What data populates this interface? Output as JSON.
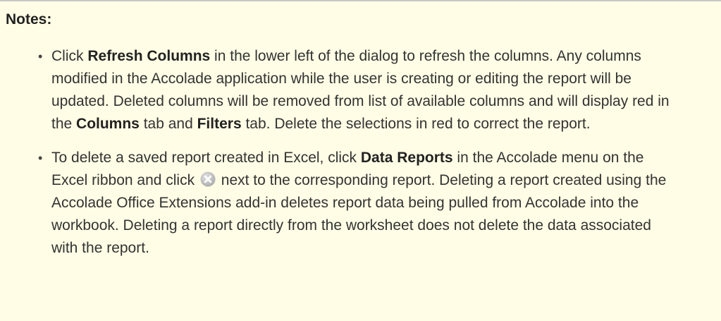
{
  "notes": {
    "title": "Notes:",
    "items": [
      {
        "parts": [
          {
            "text": "Click ",
            "bold": false
          },
          {
            "text": "Refresh Columns",
            "bold": true
          },
          {
            "text": " in the lower left of the dialog to refresh the columns. Any columns modified in the Accolade application while the user is creating or editing the report will be updated. Deleted columns will be removed from list of available columns and will display red in the ",
            "bold": false
          },
          {
            "text": "Columns",
            "bold": true
          },
          {
            "text": " tab and ",
            "bold": false
          },
          {
            "text": "Filters",
            "bold": true
          },
          {
            "text": " tab. Delete the selections in red to correct the report.",
            "bold": false
          }
        ]
      },
      {
        "parts": [
          {
            "text": "To delete a saved report created in Excel, click ",
            "bold": false
          },
          {
            "text": "Data Reports",
            "bold": true
          },
          {
            "text": " in the Accolade menu on the Excel ribbon and click ",
            "bold": false
          },
          {
            "icon": "delete-circle-icon"
          },
          {
            "text": " next to the corresponding report. Deleting a report created using the Accolade Office Extensions add-in deletes report data being pulled from Accolade into the workbook. Deleting a report directly from the worksheet does not delete the data associated with the report.",
            "bold": false
          }
        ]
      }
    ]
  },
  "colors": {
    "background": "#fffde5",
    "border": "#c8c8c8",
    "text": "#333333",
    "icon": "#b9b9b9"
  }
}
